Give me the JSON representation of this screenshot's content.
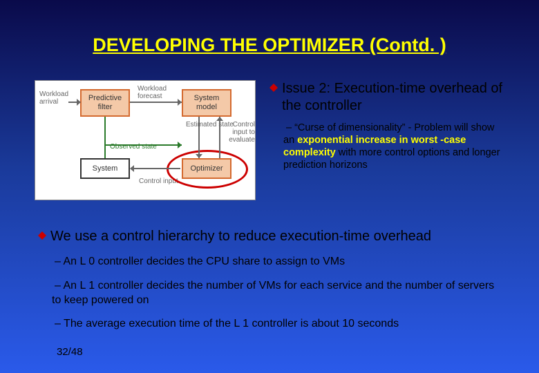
{
  "title": "DEVELOPING THE OPTIMIZER (Contd. )",
  "diagram": {
    "workload_arrival": "Workload\narrival",
    "predictive_filter": "Predictive\nfilter",
    "workload_forecast": "Workload\nforecast",
    "system_model": "System\nmodel",
    "estimated_state": "Estimated\nstate",
    "control_input_eval": "Control\ninput to\nevaluate",
    "observed_state": "Observed\nstate",
    "system": "System",
    "optimizer": "Optimizer",
    "control_input": "Control\ninput"
  },
  "issue": {
    "heading_pre": "Issue 2: Execution-time overhead of the controller",
    "sub_prefix": "– “Curse of dimensionality” - Problem will show an ",
    "sub_em": "exponential increase in worst -case complexity",
    "sub_suffix": " with more control options and longer prediction horizons"
  },
  "lower": {
    "main": "We use a control hierarchy to reduce execution-time overhead",
    "s1": "– An L 0 controller decides the CPU share to assign to VMs",
    "s2": "– An L 1 controller decides the number of VMs for each service and the number of servers to keep powered on",
    "s3": "– The average execution time of the L 1 controller is about 10 seconds"
  },
  "pagenum": "32/48"
}
